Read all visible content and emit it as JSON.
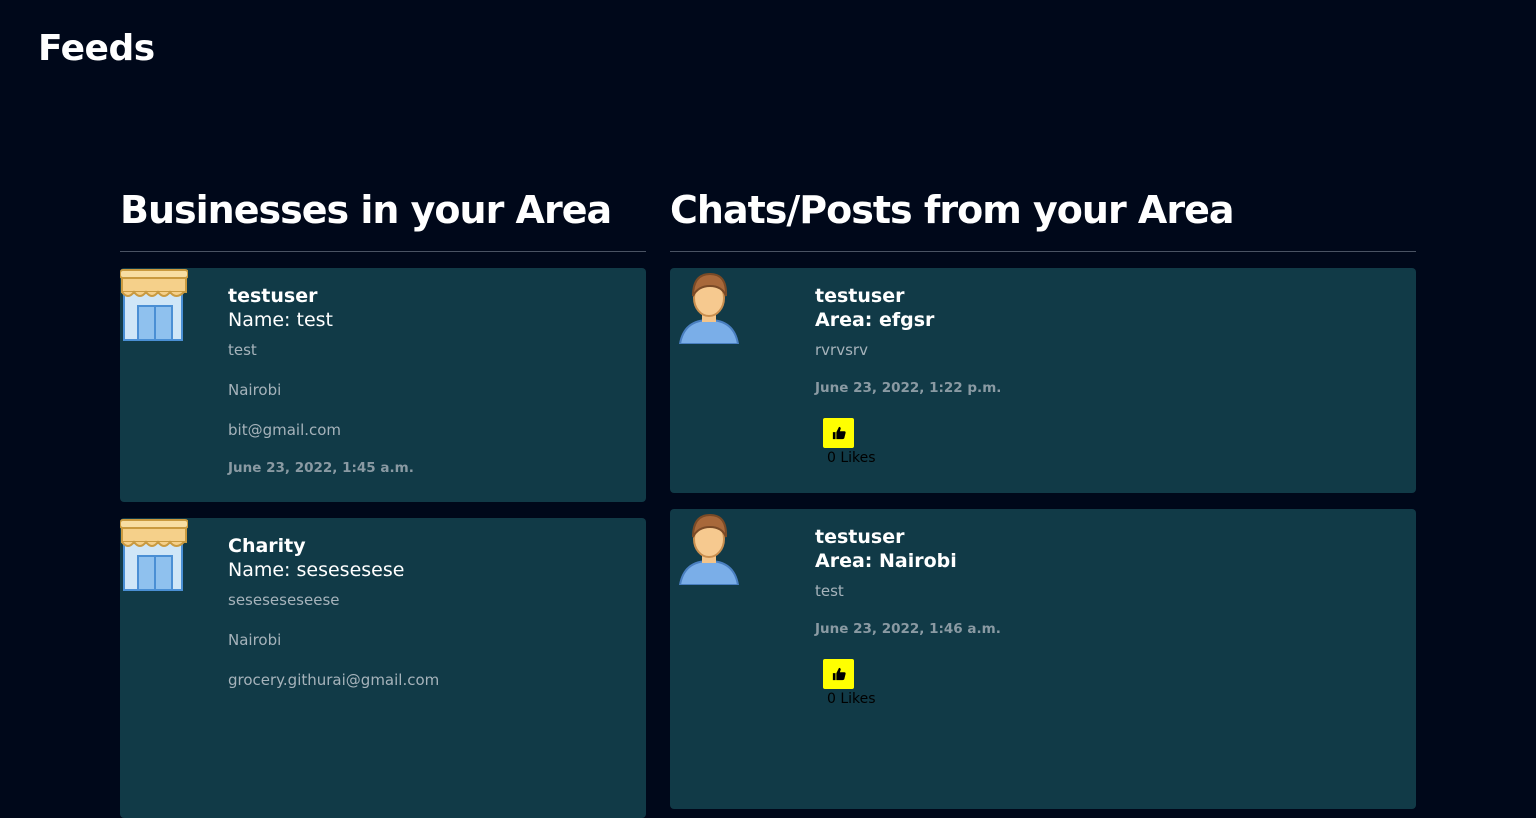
{
  "page": {
    "title": "Feeds"
  },
  "businesses": {
    "heading": "Businesses in your Area",
    "items": [
      {
        "owner": "testuser",
        "name_line": "Name: test",
        "description": "test",
        "location": "Nairobi",
        "email": "bit@gmail.com",
        "timestamp": "June 23, 2022, 1:45 a.m.",
        "icon": "shop-icon"
      },
      {
        "owner": "Charity",
        "name_line": "Name: sesesesese",
        "description": "seseseseseese",
        "location": "Nairobi",
        "email": "grocery.githurai@gmail.com",
        "icon": "shop-icon"
      }
    ]
  },
  "chats": {
    "heading": "Chats/Posts from your Area",
    "items": [
      {
        "author": "testuser",
        "area_line": "Area: efgsr",
        "message": "rvrvsrv",
        "timestamp": "June 23, 2022, 1:22 p.m.",
        "likes": "0 Likes",
        "icon": "user-avatar-icon"
      },
      {
        "author": "testuser",
        "area_line": "Area: Nairobi",
        "message": "test",
        "timestamp": "June 23, 2022, 1:46 a.m.",
        "likes": "0 Likes",
        "icon": "user-avatar-icon"
      }
    ]
  },
  "colors": {
    "background": "#00081a",
    "card": "#113a47",
    "like_button": "#ffff00"
  }
}
